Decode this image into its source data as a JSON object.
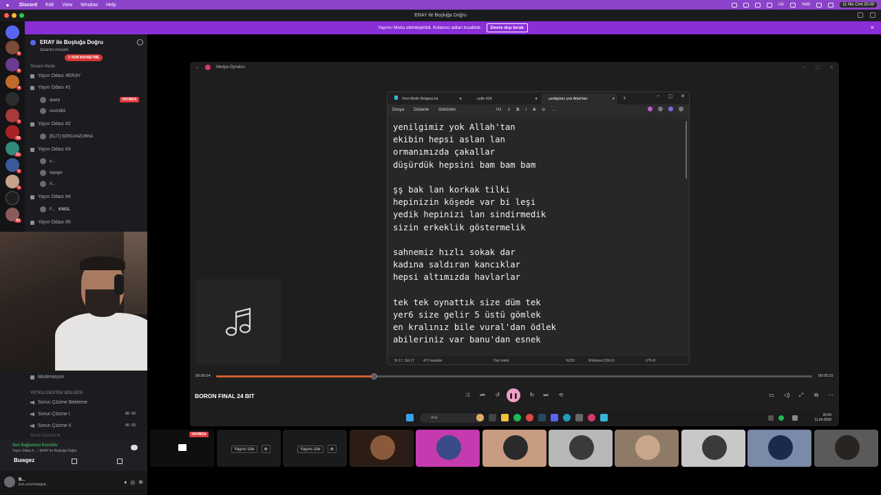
{
  "menubar": {
    "app": "Discord",
    "items": [
      "Edit",
      "View",
      "Window",
      "Help"
    ],
    "right": [
      "UA",
      "%60",
      "11 Nis Cmt  20:00"
    ]
  },
  "titlebar": {
    "title": "ERAY ile Boşluğa Doğru"
  },
  "banner": {
    "text": "Yayıncı Modu etkinleştirildi. Kullanıcı adları kısaltıldı.",
    "button": "Devre dışı bırak"
  },
  "servers": {
    "badges": [
      "5",
      "6",
      "4",
      "7",
      "38",
      "21",
      "1",
      "1",
      "82"
    ]
  },
  "sidebar": {
    "server_name": "ERAY ile Boşluğa Doğru",
    "top_channel": "tasarım-ressam",
    "new_badge": "3 YENİ BAHSETME",
    "section_stream": "Stream Mode",
    "channels": [
      {
        "name": "Yayın Odası #ERAY"
      },
      {
        "name": "Yayın Odası #1"
      },
      {
        "name": "Yayın Odası #2"
      },
      {
        "name": "Yayın Odası #3"
      },
      {
        "name": "Yayın Odası #4"
      },
      {
        "name": "Yayın Odası #5"
      }
    ],
    "users": [
      "query",
      "rest1963",
      "[ELIT] SERCANZURNA",
      "o...",
      "Vampir",
      "V...",
      "F...",
      "KNGL"
    ],
    "live_label": "YAYINDA",
    "lower": {
      "moderasyon": "Moderasyon",
      "section_support": "YETKİLİ DESTEK BÖLGESİ",
      "support": [
        "Sorun Çözme Bekleme",
        "Sorun Çözme I",
        "Sorun Çözme II",
        "Sorun Çözme III"
      ],
      "counts": [
        "00",
        "02",
        "00",
        "02"
      ]
    }
  },
  "userpanel": {
    "voice_status": "Ses Bağlantısı Kuruldu",
    "voice_channel": "Yayın Odası #... / ERAY ile Boşluğa Doğru",
    "stream_name": "Buwgez",
    "username": "B...",
    "status": "kick.com/imbigbat"
  },
  "media_player": {
    "title": "Medya Oynatıcı",
    "track": "BORON FINAL 24 BIT",
    "time_elapsed": "00:00:24",
    "time_total": "00:05:10",
    "progress": 0.264
  },
  "notepad": {
    "tabs": [
      "Yeni Metin Belgesi.txt",
      "çelik 424",
      "yenilgimiz yok Allah'tan"
    ],
    "menu": [
      "Dosya",
      "Düzenle",
      "Görünüm"
    ],
    "format": [
      "H1",
      "≡",
      "B",
      "I",
      "S",
      "⊝",
      "…"
    ],
    "lines": [
      "yenilgimiz yok Allah'tan",
      "ekibin hepsi aslan lan",
      "ormanımızda çakallar",
      "düşürdük hepsini bam bam bam",
      "",
      "şş bak lan korkak tilki",
      "hepinizin köşede var bi leşi",
      "yedik hepinizi lan sindirmedik",
      "sizin erkeklik göstermelik",
      "",
      "sahnemiz hızlı sokak dar",
      "kadına saldıran kancıklar",
      "hepsi altımızda havlarlar",
      "",
      "tek tek oynattık size düm tek",
      "yer6 size gelir 5 üstü gömlek",
      "en kralınız bile vural'dan ödlek",
      "abileriniz var banu'dan esnek"
    ],
    "status": {
      "position": "St 17, Süt 17",
      "chars": "471 karakter",
      "format": "Düz metin",
      "zoom": "%220",
      "eol": "Windows (CRLF)",
      "encoding": "UTF-8"
    }
  },
  "taskbar": {
    "search": "Ara",
    "time": "20:00",
    "date": "11.04.2026"
  },
  "callbar": {
    "live": "YAYINDA",
    "watch": "Yayını izle"
  },
  "colors": {
    "accent": "#8a2ed8",
    "live": "#e03b3b",
    "progress": "#d4602f",
    "play": "#f0a0c8"
  }
}
